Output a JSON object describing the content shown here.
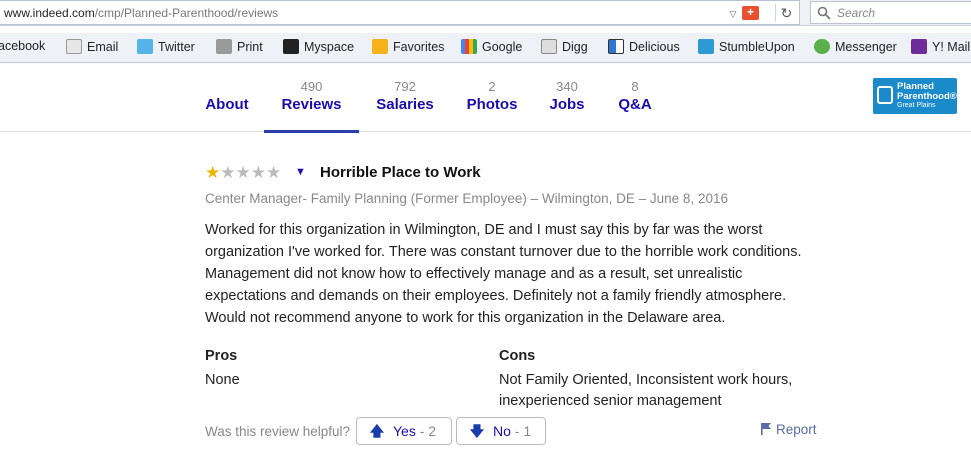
{
  "browser": {
    "url_host": "www.indeed.com",
    "url_path": "/cmp/Planned-Parenthood/reviews",
    "search_placeholder": "Search",
    "bookmarks": [
      {
        "label": "acebook",
        "icon": "facebook-icon"
      },
      {
        "label": "Email",
        "icon": "email-icon"
      },
      {
        "label": "Twitter",
        "icon": "twitter-icon"
      },
      {
        "label": "Print",
        "icon": "printer-icon"
      },
      {
        "label": "Myspace",
        "icon": "myspace-icon"
      },
      {
        "label": "Favorites",
        "icon": "star-icon"
      },
      {
        "label": "Google",
        "icon": "google-icon"
      },
      {
        "label": "Digg",
        "icon": "digg-icon"
      },
      {
        "label": "Delicious",
        "icon": "delicious-icon"
      },
      {
        "label": "StumbleUpon",
        "icon": "stumbleupon-icon"
      },
      {
        "label": "Messenger",
        "icon": "messenger-icon"
      },
      {
        "label": "Y! Mail",
        "icon": "yahoo-mail-icon"
      }
    ]
  },
  "tabs": [
    {
      "label": "About",
      "count": ""
    },
    {
      "label": "Reviews",
      "count": "490"
    },
    {
      "label": "Salaries",
      "count": "792"
    },
    {
      "label": "Photos",
      "count": "2"
    },
    {
      "label": "Jobs",
      "count": "340"
    },
    {
      "label": "Q&A",
      "count": "8"
    }
  ],
  "active_tab": "Reviews",
  "logo": {
    "line1": "Planned",
    "line2": "Parenthood®",
    "line3": "Great Plains"
  },
  "review": {
    "rating": 1,
    "max_rating": 5,
    "title": "Horrible Place to Work",
    "meta": "Center Manager- Family Planning (Former Employee) –  Wilmington, DE – June 8, 2016",
    "body": "Worked for this organization in Wilmington, DE and I must say this by far was the worst organization I've worked for. There was constant turnover due to the horrible work conditions. Management did not know how to effectively manage and as a result, set unrealistic expectations and demands on their employees. Definitely not a family friendly atmosphere. Would not recommend anyone to work for this organization in the Delaware area.",
    "pros_heading": "Pros",
    "pros": "None",
    "cons_heading": "Cons",
    "cons": "Not Family Oriented, Inconsistent work hours, inexperienced senior management",
    "helpful_prompt": "Was this review helpful?",
    "yes_label": "Yes",
    "yes_count": "- 2",
    "no_label": "No",
    "no_count": "- 1",
    "report_label": "Report"
  },
  "colors": {
    "link": "#1a0dab",
    "star_on": "#f0b400",
    "star_off": "#bbbbbb",
    "active_tab_underline": "#2a3fab"
  }
}
